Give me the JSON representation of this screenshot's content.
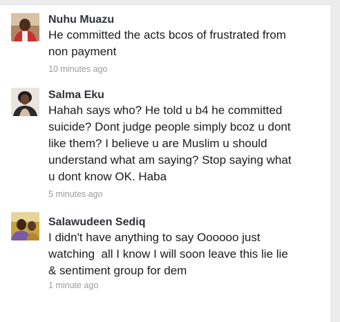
{
  "comments": [
    {
      "author": "Nuhu Muazu",
      "avatar_icon": "user-avatar-icon",
      "avatar_colors": {
        "bg": "#9b6b4a",
        "accent": "#c9302c",
        "face": "#4a2e1e"
      },
      "lines": [
        "He committed the acts bcos of frustrated from",
        "non payment"
      ],
      "time": "10 minutes ago"
    },
    {
      "author": "Salma Eku",
      "avatar_icon": "user-avatar-icon",
      "avatar_colors": {
        "bg": "#e7e2dc",
        "accent": "#1d1d1d",
        "face": "#5a3a27"
      },
      "lines": [
        "Hahah says who? He told u b4 he committed",
        "suicide? Dont judge people simply bcoz u dont",
        "like them? I believe u are Muslim u should",
        "understand what am saying? Stop saying what",
        "u dont know OK. Haba"
      ],
      "time": "5 minutes ago"
    },
    {
      "author": "Salawudeen Sediq",
      "avatar_icon": "user-avatar-icon",
      "avatar_colors": {
        "bg": "#c9a23c",
        "accent": "#7a5aa8",
        "face": "#3d2618"
      },
      "lines": [
        "I didn't have anything to say Oooooo just",
        "watching  all I know I will soon leave this lie lie",
        "& sentiment group for dem"
      ],
      "time": "1 minute ago"
    }
  ]
}
